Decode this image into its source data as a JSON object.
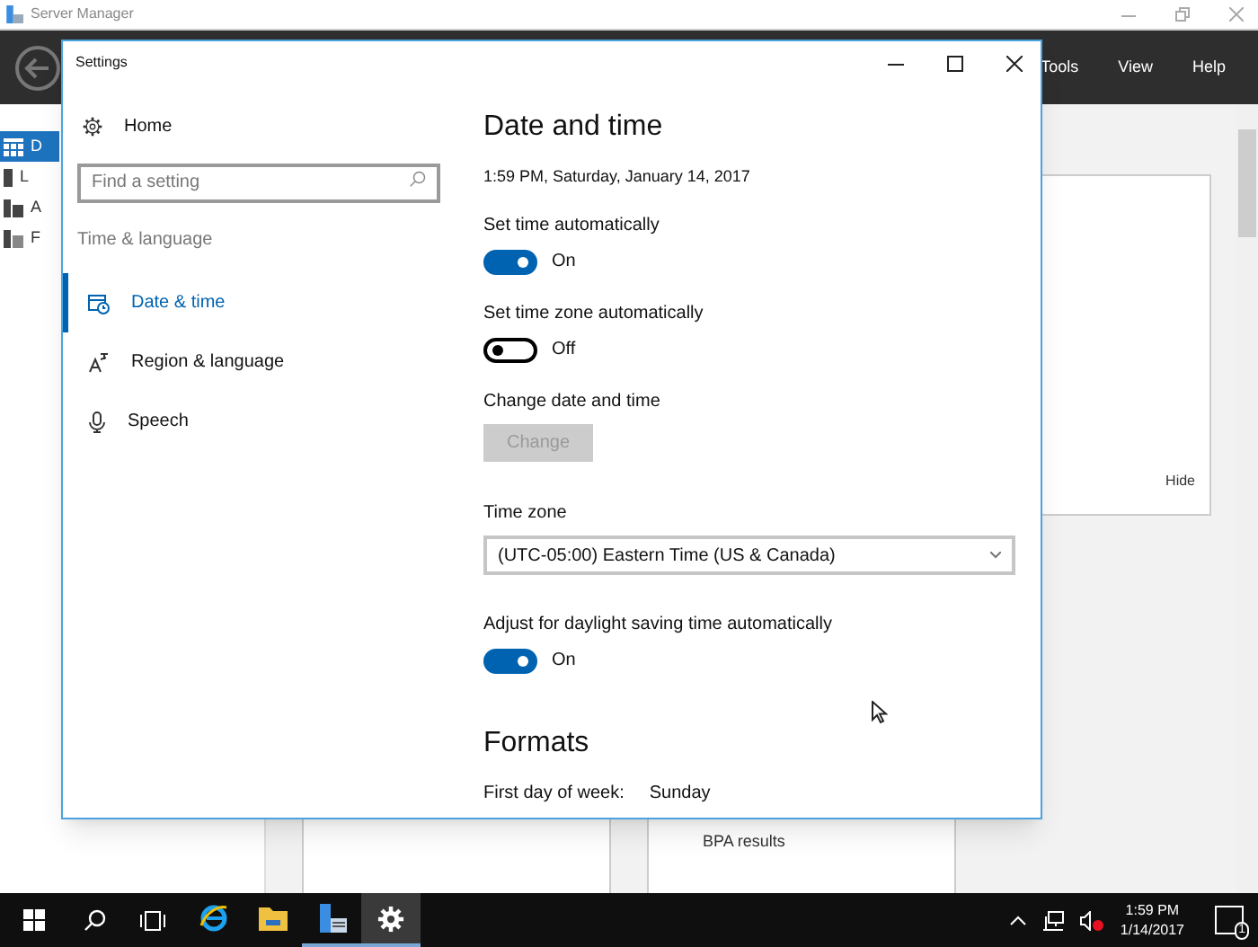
{
  "server_manager": {
    "title": "Server Manager",
    "menu": [
      "Tools",
      "View",
      "Help"
    ],
    "nav_items": [
      {
        "label": "D",
        "selected": true
      },
      {
        "label": "L",
        "selected": false
      },
      {
        "label": "A",
        "selected": false
      },
      {
        "label": "F",
        "selected": false
      }
    ],
    "hide_link": "Hide",
    "tile_text": "BPA results"
  },
  "settings": {
    "title": "Settings",
    "home": "Home",
    "search": {
      "placeholder": "Find a setting"
    },
    "section": "Time & language",
    "nav": [
      {
        "label": "Date & time",
        "selected": true
      },
      {
        "label": "Region & language",
        "selected": false
      },
      {
        "label": "Speech",
        "selected": false
      }
    ],
    "page_title": "Date and time",
    "current_time": "1:59 PM, Saturday, January 14, 2017",
    "items": [
      {
        "kind": "toggle",
        "label": "Set time automatically",
        "on": true,
        "state_text": "On"
      },
      {
        "kind": "toggle",
        "label": "Set time zone automatically",
        "on": false,
        "state_text": "Off"
      },
      {
        "kind": "button",
        "label": "Change date and time",
        "button": "Change",
        "disabled": true
      },
      {
        "kind": "dropdown",
        "label": "Time zone",
        "value": "(UTC-05:00) Eastern Time (US & Canada)"
      },
      {
        "kind": "toggle",
        "label": "Adjust for daylight saving time automatically",
        "on": true,
        "state_text": "On"
      },
      {
        "kind": "heading",
        "label": "Formats"
      },
      {
        "kind": "value_row",
        "label": "First day of week:",
        "value": "Sunday"
      }
    ]
  },
  "taskbar": {
    "apps": [
      {
        "running": false,
        "selected": false
      },
      {
        "running": false,
        "selected": false
      },
      {
        "running": true,
        "selected": false
      },
      {
        "running": true,
        "selected": true
      }
    ],
    "time": "1:59 PM",
    "date": "1/14/2017",
    "notification_count": "1"
  }
}
